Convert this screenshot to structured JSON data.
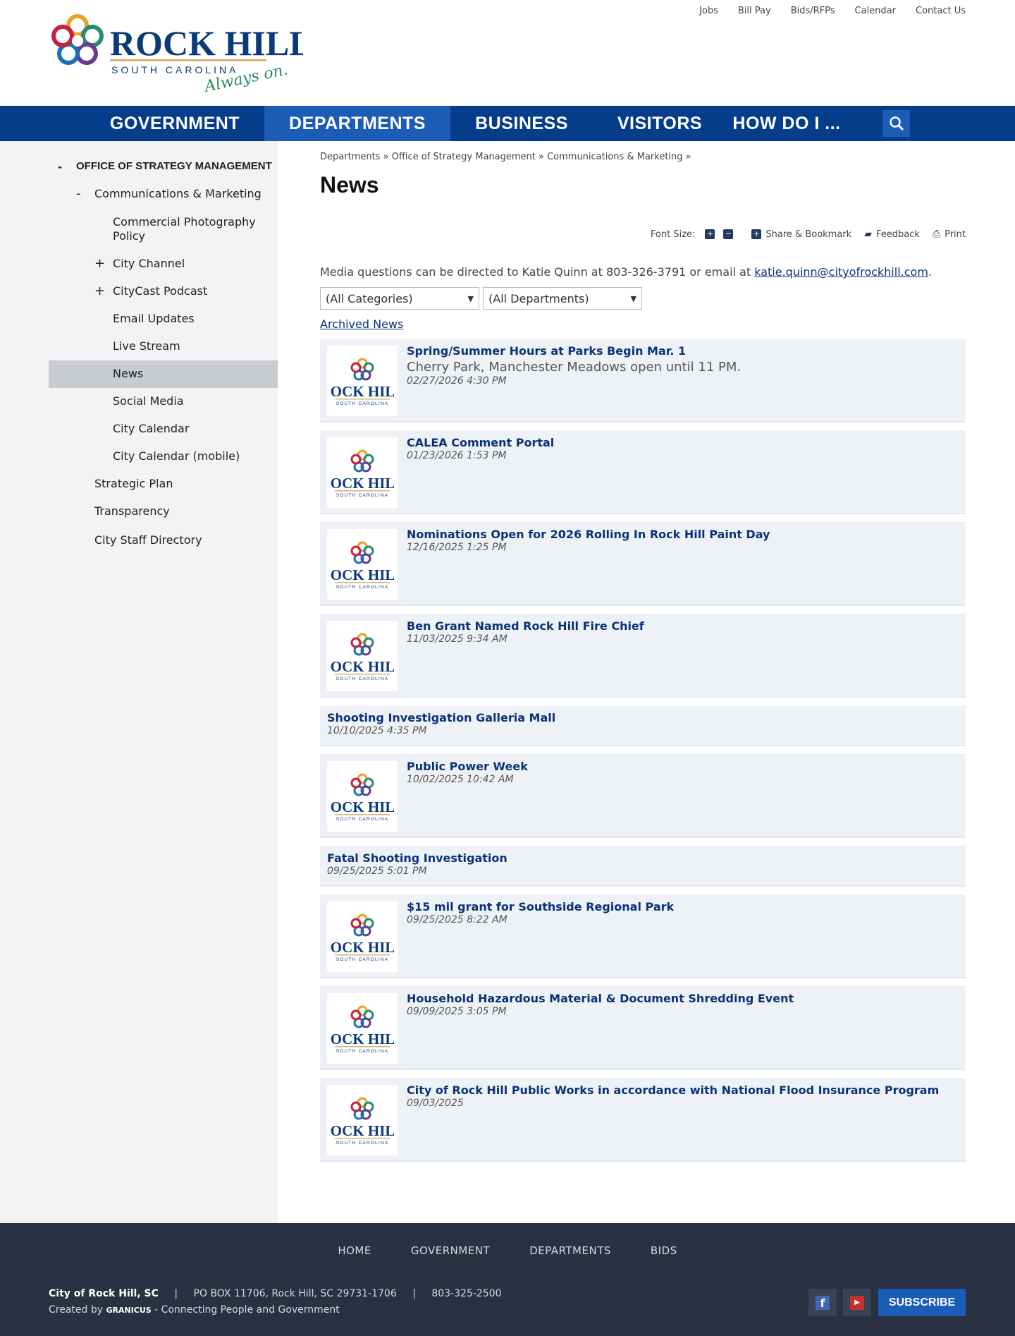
{
  "header": {
    "top_links": [
      "Jobs",
      "Bill Pay",
      "Bids/RFPs",
      "Calendar",
      "Contact Us"
    ],
    "logo": {
      "name": "ROCK HILL",
      "state": "SOUTH CAROLINA",
      "tagline": "Always on."
    }
  },
  "nav": {
    "items": [
      "GOVERNMENT",
      "DEPARTMENTS",
      "BUSINESS",
      "VISITORS",
      "HOW DO I ..."
    ],
    "active": "DEPARTMENTS",
    "search_icon": "search-icon"
  },
  "sidebar": {
    "section": "OFFICE OF STRATEGY MANAGEMENT",
    "items": [
      {
        "label": "Communications & Marketing",
        "sign": "-"
      },
      {
        "label": "Commercial Photography Policy",
        "sign": ""
      },
      {
        "label": "City Channel",
        "sign": "+"
      },
      {
        "label": "CityCast Podcast",
        "sign": "+"
      },
      {
        "label": "Email Updates",
        "sign": ""
      },
      {
        "label": "Live Stream",
        "sign": ""
      },
      {
        "label": "News",
        "sign": ""
      },
      {
        "label": "Social Media",
        "sign": ""
      },
      {
        "label": "City Calendar",
        "sign": ""
      },
      {
        "label": "City Calendar (mobile)",
        "sign": ""
      },
      {
        "label": "Strategic Plan",
        "sign": ""
      },
      {
        "label": "Transparency",
        "sign": ""
      },
      {
        "label": "City Staff Directory",
        "sign": ""
      }
    ],
    "section_sign": "-"
  },
  "main": {
    "breadcrumb": "Departments » Office of Strategy Management » Communications & Marketing »",
    "title": "News",
    "tools": {
      "font_size": "Font Size:",
      "share": "Share & Bookmark",
      "feedback": "Feedback",
      "print": "Print"
    },
    "media_text": "Media questions can be directed to Katie Quinn at 803-326-3791 or email at ",
    "media_email": "katie.quinn@cityofrockhill.com",
    "category_select": "(All Categories)",
    "department_select": "(All Departments)",
    "archived": "Archived News",
    "news": [
      {
        "title": "Spring/Summer Hours at Parks Begin Mar. 1",
        "summary": "Cherry Park, Manchester Meadows open until 11 PM.",
        "date": "02/27/2026 4:30 PM",
        "image": true
      },
      {
        "title": "CALEA Comment Portal",
        "date": "01/23/2026 1:53 PM",
        "image": true
      },
      {
        "title": "Nominations Open for 2026 Rolling In Rock Hill Paint Day",
        "date": "12/16/2025 1:25 PM",
        "image": true
      },
      {
        "title": "Ben Grant Named Rock Hill Fire Chief",
        "date": "11/03/2025 9:34 AM",
        "image": true
      },
      {
        "title": "Shooting Investigation Galleria Mall",
        "date": "10/10/2025 4:35 PM",
        "image": false
      },
      {
        "title": "Public Power Week",
        "date": "10/02/2025 10:42 AM",
        "image": true
      },
      {
        "title": "Fatal Shooting Investigation",
        "date": "09/25/2025 5:01 PM",
        "image": false
      },
      {
        "title": "$15 mil grant for Southside Regional Park",
        "date": "09/25/2025 8:22 AM",
        "image": true
      },
      {
        "title": "Household Hazardous Material & Document Shredding Event",
        "date": "09/09/2025 3:05 PM",
        "image": true
      },
      {
        "title": "City of Rock Hill Public Works in accordance with National Flood Insurance Program",
        "date": "09/03/2025",
        "image": true
      }
    ]
  },
  "footer": {
    "links": [
      "HOME",
      "GOVERNMENT",
      "DEPARTMENTS",
      "BIDS"
    ],
    "org": "City of Rock Hill, SC",
    "address": "PO BOX 11706, Rock Hill, SC 29731-1706",
    "phone": "803-325-2500",
    "created_by": "Created by ",
    "granicus": "GRANICUS",
    "tagline": " - Connecting People and Government",
    "subscribe": "SUBSCRIBE",
    "sep": "|"
  },
  "colors": {
    "nav": "#053d8b",
    "nav_active": "#1b5cb6",
    "link": "#0b3276",
    "footer": "#293142"
  }
}
